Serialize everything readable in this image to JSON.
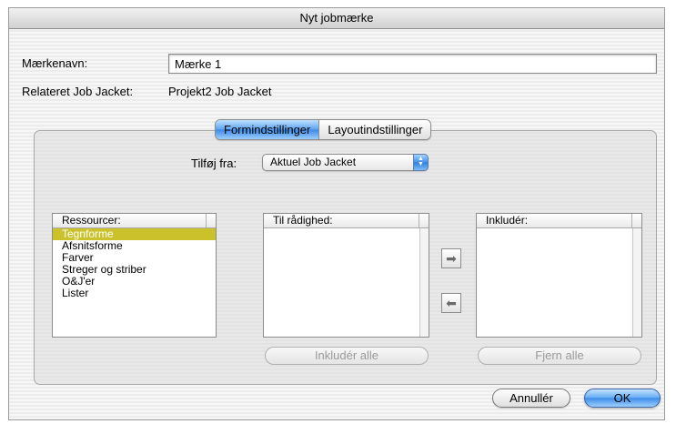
{
  "window": {
    "title": "Nyt jobmærke"
  },
  "form": {
    "name_label": "Mærkenavn:",
    "name_value": "Mærke 1",
    "related_label": "Relateret Job Jacket:",
    "related_value": "Projekt2 Job Jacket"
  },
  "tabs": [
    {
      "label": "Formindstillinger",
      "active": true
    },
    {
      "label": "Layoutindstillinger",
      "active": false
    }
  ],
  "add_from": {
    "label": "Tilføj fra:",
    "selected": "Aktuel Job Jacket"
  },
  "resources": {
    "header": "Ressourcer:",
    "items": [
      "Tegnforme",
      "Afsnitsforme",
      "Farver",
      "Streger og striber",
      "O&J'er",
      "Lister"
    ],
    "selected_index": 0
  },
  "available": {
    "header": "Til rådighed:"
  },
  "include": {
    "header": "Inkludér:"
  },
  "buttons": {
    "include_all": "Inkludér alle",
    "remove_all": "Fjern alle",
    "cancel": "Annullér",
    "ok": "OK"
  },
  "icons": {
    "move_right": "arrow-right-icon",
    "move_left": "arrow-left-icon",
    "popup": "up-down-arrows-icon"
  },
  "colors": {
    "selection": "#cbc12a",
    "accent": "#3e8ee8"
  }
}
